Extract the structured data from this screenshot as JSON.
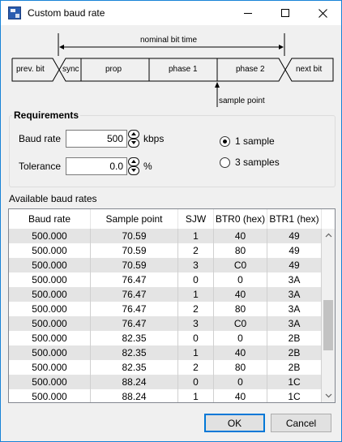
{
  "window": {
    "title": "Custom baud rate",
    "icon": "app-icon"
  },
  "diagram": {
    "nominal_label": "nominal bit time",
    "segments": [
      "prev. bit",
      "sync",
      "prop",
      "phase 1",
      "phase 2",
      "next bit"
    ],
    "sample_point_label": "sample point"
  },
  "requirements": {
    "title": "Requirements",
    "baud_rate_label": "Baud rate",
    "baud_rate_value": "500",
    "baud_rate_unit": "kbps",
    "tolerance_label": "Tolerance",
    "tolerance_value": "0.0",
    "tolerance_unit": "%",
    "sample_options": [
      "1 sample",
      "3 samples"
    ],
    "selected_sample": "1 sample"
  },
  "table": {
    "label": "Available baud rates",
    "columns": [
      "Baud rate",
      "Sample point",
      "SJW",
      "BTR0 (hex)",
      "BTR1 (hex)"
    ],
    "rows": [
      [
        "500.000",
        "70.59",
        "1",
        "40",
        "49"
      ],
      [
        "500.000",
        "70.59",
        "2",
        "80",
        "49"
      ],
      [
        "500.000",
        "70.59",
        "3",
        "C0",
        "49"
      ],
      [
        "500.000",
        "76.47",
        "0",
        "0",
        "3A"
      ],
      [
        "500.000",
        "76.47",
        "1",
        "40",
        "3A"
      ],
      [
        "500.000",
        "76.47",
        "2",
        "80",
        "3A"
      ],
      [
        "500.000",
        "76.47",
        "3",
        "C0",
        "3A"
      ],
      [
        "500.000",
        "82.35",
        "0",
        "0",
        "2B"
      ],
      [
        "500.000",
        "82.35",
        "1",
        "40",
        "2B"
      ],
      [
        "500.000",
        "82.35",
        "2",
        "80",
        "2B"
      ],
      [
        "500.000",
        "88.24",
        "0",
        "0",
        "1C"
      ],
      [
        "500.000",
        "88.24",
        "1",
        "40",
        "1C"
      ]
    ]
  },
  "buttons": {
    "ok": "OK",
    "cancel": "Cancel"
  }
}
